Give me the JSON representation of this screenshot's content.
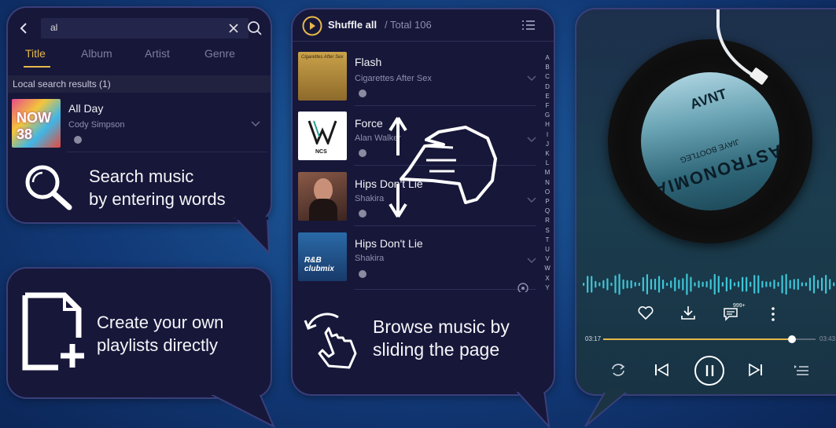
{
  "search_panel": {
    "query": "al",
    "tabs": [
      "Title",
      "Album",
      "Artist",
      "Genre"
    ],
    "active_tab": "Title",
    "results_header": "Local search results (1)",
    "result": {
      "title": "All Day",
      "artist": "Cody Simpson",
      "art_text": "NOW 38"
    },
    "feature_line1": "Search music",
    "feature_line2": "by entering words",
    "icons": [
      "back-icon",
      "clear-icon",
      "search-icon",
      "chevron-down-icon",
      "magnifier-icon"
    ]
  },
  "playlist_panel": {
    "feature_line1": "Create your own",
    "feature_line2": "playlists directly",
    "icons": [
      "new-playlist-icon"
    ]
  },
  "browse_panel": {
    "shuffle_label": "Shuffle all",
    "total_label": "/ Total 106",
    "songs": [
      {
        "title": "Flash",
        "artist": "Cigarettes After Sex",
        "art_text": "Cigarettes After Sex"
      },
      {
        "title": "Force",
        "artist": "Alan Walker",
        "art_text": "NCS"
      },
      {
        "title": "Hips Don't Lie",
        "artist": "Shakira",
        "art_text": ""
      },
      {
        "title": "Hips Don't Lie",
        "artist": "Shakira",
        "art_text": "R&B clubmix"
      }
    ],
    "alphabet": [
      "A",
      "B",
      "C",
      "D",
      "E",
      "F",
      "G",
      "H",
      "I",
      "J",
      "K",
      "L",
      "M",
      "N",
      "O",
      "P",
      "Q",
      "R",
      "S",
      "T",
      "U",
      "V",
      "W",
      "X",
      "Y"
    ],
    "feature_line1": "Browse music by",
    "feature_line2": "sliding the page",
    "icons": [
      "play-circle-icon",
      "list-menu-icon",
      "swipe-hand-icon",
      "slide-hand-icon"
    ]
  },
  "player_panel": {
    "record_label_logo": "AVNT",
    "record_label_title": "ASTRONOMIA",
    "record_label_sub": "JIAYE BOOTLEG",
    "comment_count": "999+",
    "time_current": "03:17",
    "time_total": "03:43",
    "progress": 0.89,
    "colors": {
      "accent": "#e6b84a",
      "wave": "#3ec5d6"
    },
    "icons": [
      "heart-icon",
      "download-icon",
      "comment-icon",
      "more-icon",
      "repeat-icon",
      "previous-icon",
      "pause-icon",
      "next-icon",
      "queue-icon"
    ]
  }
}
